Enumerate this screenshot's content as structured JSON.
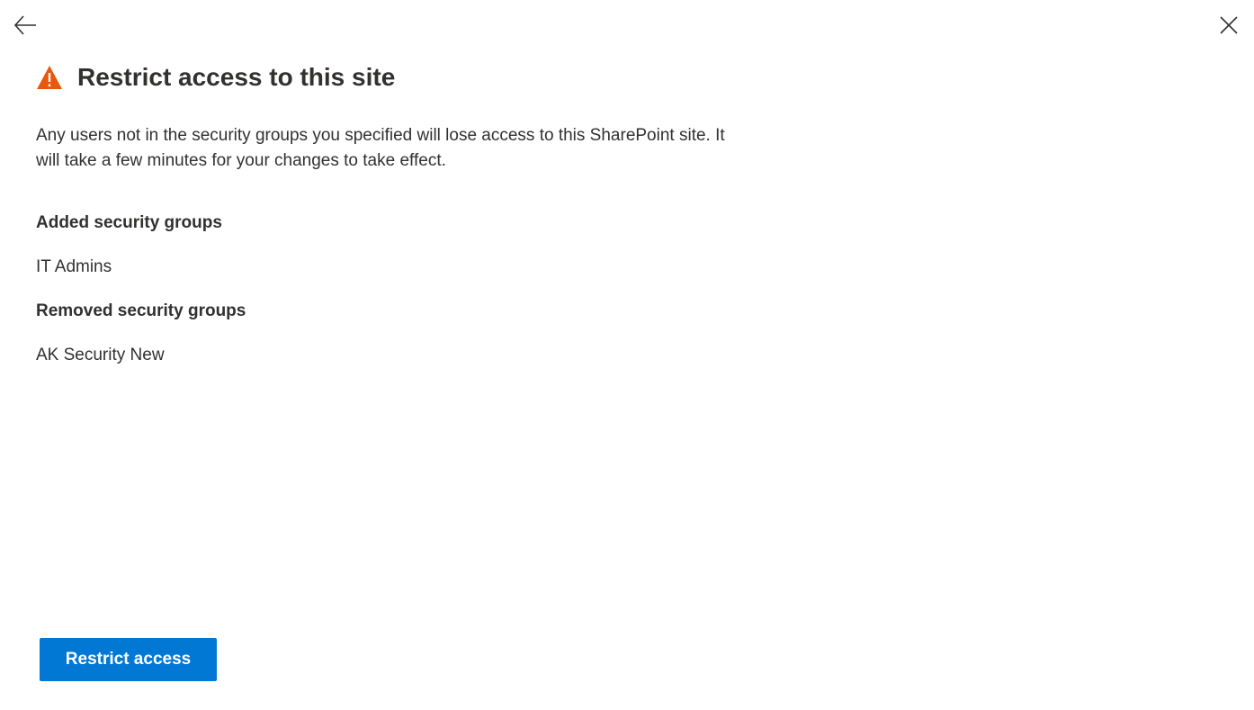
{
  "nav": {
    "back_icon": "back-arrow-icon",
    "close_icon": "close-icon"
  },
  "header": {
    "icon": "warning-icon",
    "icon_color": "#e8590c",
    "title": "Restrict access to this site"
  },
  "description": "Any users not in the security groups you specified will lose access to this SharePoint site. It will take a few minutes for your changes to take effect.",
  "added": {
    "heading": "Added security groups",
    "value": "IT Admins"
  },
  "removed": {
    "heading": "Removed security groups",
    "value": "AK Security New"
  },
  "footer": {
    "primary_label": "Restrict access",
    "primary_color": "#0078d4"
  }
}
